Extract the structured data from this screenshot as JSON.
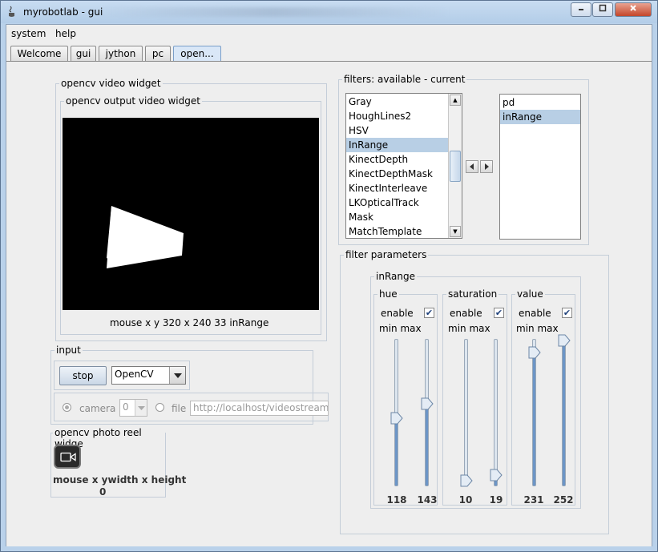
{
  "window": {
    "title": "myrobotlab - gui"
  },
  "menu": [
    "system",
    "help"
  ],
  "tabs": [
    "Welcome",
    "gui",
    "jython",
    "pc",
    "open..."
  ],
  "video_widget": {
    "title": "opencv  video widget",
    "output_title": "opencv output video widget",
    "status": "mouse x y   320 x 240  33  inRange"
  },
  "input": {
    "title": "input",
    "stop_label": "stop",
    "source_value": "OpenCV",
    "camera_label": "camera",
    "camera_index": "0",
    "file_label": "file",
    "url_value": "http://localhost/videostream.cgi"
  },
  "photo_reel": {
    "title": "opencv  photo reel widge",
    "status": "mouse x ywidth x height",
    "value": "0"
  },
  "filters": {
    "title": "filters: available - current",
    "available": [
      "Gray",
      "HoughLines2",
      "HSV",
      "InRange",
      "KinectDepth",
      "KinectDepthMask",
      "KinectInterleave",
      "LKOpticalTrack",
      "Mask",
      "MatchTemplate"
    ],
    "available_selected": "InRange",
    "current": [
      "pd",
      "inRange"
    ],
    "current_selected": "inRange"
  },
  "params": {
    "title": "filter parameters",
    "filter_name": "inRange",
    "enable_label": "enable",
    "minmax_label": "min max",
    "channels": [
      {
        "name": "hue",
        "enabled": true,
        "min": 118,
        "max": 143,
        "min_fraction": 0.463,
        "max_fraction": 0.561
      },
      {
        "name": "saturation",
        "enabled": true,
        "min": 10,
        "max": 19,
        "min_fraction": 0.039,
        "max_fraction": 0.075
      },
      {
        "name": "value",
        "enabled": true,
        "min": 231,
        "max": 252,
        "min_fraction": 0.906,
        "max_fraction": 0.988
      }
    ]
  }
}
